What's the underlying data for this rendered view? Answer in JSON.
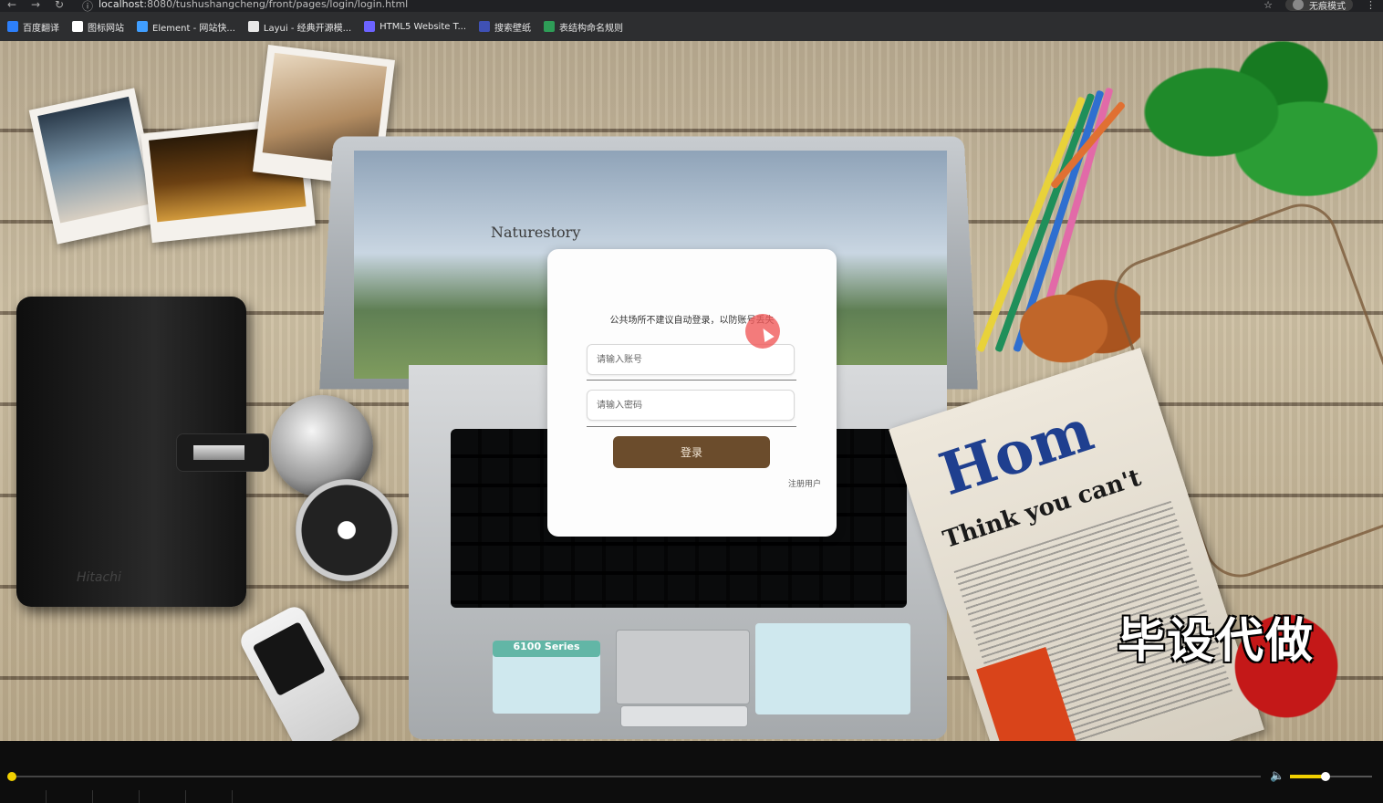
{
  "browser": {
    "url_host": "localhost",
    "url_rest": ":8080/tushushangcheng/front/pages/login/login.html",
    "profile_label": "无痕模式",
    "bookmarks": [
      {
        "label": "百度翻译",
        "color": "#2d7ff9"
      },
      {
        "label": "图标网站",
        "color": "#ffffff"
      },
      {
        "label": "Element - 网站快...",
        "color": "#409eff"
      },
      {
        "label": "Layui - 经典开源模...",
        "color": "#e8e8e8"
      },
      {
        "label": "HTML5 Website T...",
        "color": "#6c63ff"
      },
      {
        "label": "搜索壁纸",
        "color": "#3f51b5"
      },
      {
        "label": "表结构命名规则",
        "color": "#2e9d57"
      }
    ]
  },
  "scene": {
    "laptop_logo": "Naturestory",
    "wallet_brand": "Hitachi",
    "sticker_series": "6100 Series",
    "newspaper_headline": "Hom",
    "newspaper_subhead": "Think you can't",
    "watermark": "毕设代做"
  },
  "login": {
    "tip": "公共场所不建议自动登录，以防账号丢失",
    "username_placeholder": "请输入账号",
    "password_placeholder": "请输入密码",
    "login_button": "登录",
    "register_link": "注册用户",
    "button_color": "#6b4c2c"
  },
  "player": {
    "progress_fraction": 0.0,
    "volume_fraction": 0.45,
    "accent_color": "#f1d000"
  }
}
